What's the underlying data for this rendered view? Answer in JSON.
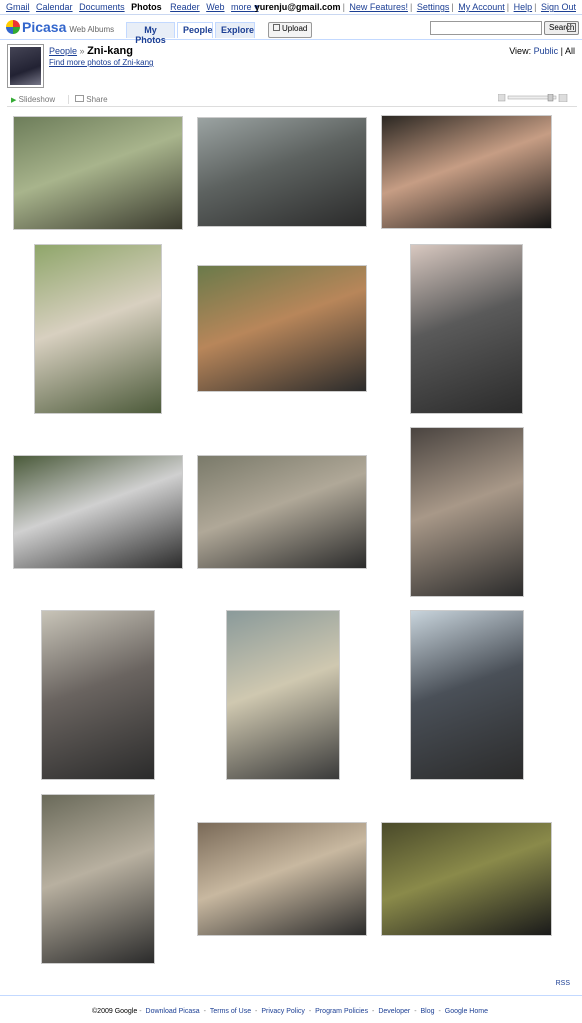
{
  "gbar": {
    "links": [
      "Gmail",
      "Calendar",
      "Documents",
      "Photos",
      "Reader",
      "Web",
      "more ▾"
    ],
    "current": "Photos",
    "email": "yurenju@gmail.com",
    "right_links": [
      "New Features!",
      "Settings",
      "My Account",
      "Help",
      "Sign Out"
    ]
  },
  "header": {
    "logo": "Picasa",
    "logo_sub": "Web Albums",
    "tabs": [
      "My Photos",
      "People",
      "Explore"
    ],
    "active_tab": "People",
    "upload": "Upload",
    "search_button": "Search"
  },
  "person": {
    "breadcrumb_root": "People",
    "breadcrumb_sep": "»",
    "name": "Zni-kang",
    "find_more": "Find more photos of Zni-kang",
    "view_label": "View:",
    "view_public": "Public",
    "view_sep": "|",
    "view_all": "All"
  },
  "toolbar": {
    "slideshow": "Slideshow",
    "share": "Share"
  },
  "photos": [
    {
      "colors": [
        "#6d7d5a",
        "#a8b48c",
        "#3a3a2e"
      ]
    },
    {
      "colors": [
        "#9ba3a2",
        "#5d6260",
        "#2b2b2b"
      ]
    },
    {
      "colors": [
        "#2b2722",
        "#c69d84",
        "#141414"
      ]
    },
    {
      "colors": [
        "#8fa66a",
        "#d8d0c0",
        "#4c5a3a"
      ]
    },
    {
      "colors": [
        "#6a7a4a",
        "#b8865a",
        "#2b2b2b"
      ]
    },
    {
      "colors": [
        "#d8c8c0",
        "#5a5a5a",
        "#2b2b2b"
      ]
    },
    {
      "colors": [
        "#4a5a3a",
        "#d0d0d0",
        "#2b2b2b"
      ]
    },
    {
      "colors": [
        "#7a7a6a",
        "#b0a898",
        "#2b2b2b"
      ]
    },
    {
      "colors": [
        "#4a4440",
        "#a89888",
        "#2b2b2b"
      ]
    },
    {
      "colors": [
        "#c8c4b8",
        "#6a6460",
        "#2b2b2b"
      ]
    },
    {
      "colors": [
        "#8a9a9a",
        "#cfc8b0",
        "#3a3a3a"
      ]
    },
    {
      "colors": [
        "#c8d4dc",
        "#4a5058",
        "#2b2b2b"
      ]
    },
    {
      "colors": [
        "#6a6a5a",
        "#b8b0a0",
        "#2b2b2b"
      ]
    },
    {
      "colors": [
        "#7a6a58",
        "#c8b8a0",
        "#2b2b2b"
      ]
    },
    {
      "colors": [
        "#4a4a2a",
        "#8a8a4a",
        "#1a1a1a"
      ]
    }
  ],
  "footer": {
    "rss": "RSS",
    "copyright": "©2009 Google",
    "links": [
      "Download Picasa",
      "Terms of Use",
      "Privacy Policy",
      "Program Policies",
      "Developer",
      "Blog",
      "Google Home"
    ]
  }
}
